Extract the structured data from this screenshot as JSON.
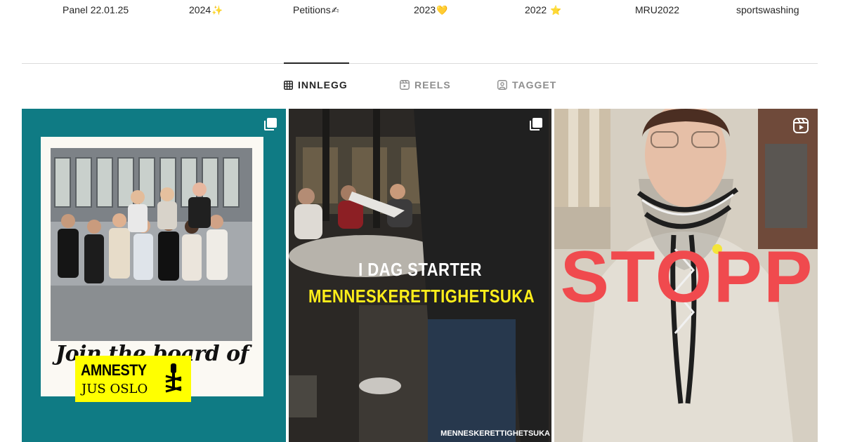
{
  "highlights": [
    {
      "label": "Panel 22.01.25",
      "emoji": ""
    },
    {
      "label": "2024",
      "emoji": "✨"
    },
    {
      "label": "Petitions",
      "emoji": "✍"
    },
    {
      "label": "2023",
      "emoji": "💛"
    },
    {
      "label": "2022",
      "emoji": "⭐"
    },
    {
      "label": "MRU2022",
      "emoji": ""
    },
    {
      "label": "sportswashing",
      "emoji": ""
    }
  ],
  "tabs": [
    {
      "label": "INNLEGG",
      "icon": "grid-icon",
      "active": true
    },
    {
      "label": "REELS",
      "icon": "reels-icon",
      "active": false
    },
    {
      "label": "TAGGET",
      "icon": "tagged-icon",
      "active": false
    }
  ],
  "posts": [
    {
      "type": "carousel",
      "badge_icon": "carousel-icon",
      "caption": "Join the board of",
      "logo_line1": "AMNESTY",
      "logo_line2": "JUS OSLO"
    },
    {
      "type": "carousel",
      "badge_icon": "carousel-icon",
      "line1": "I DAG STARTER",
      "line2": "MENNESKERETTIGHETSUKA",
      "footer": "MENNESKERETTIGHETSUKA"
    },
    {
      "type": "reel",
      "badge_icon": "reel-icon",
      "overlay": "STOPP"
    }
  ],
  "colors": {
    "tile1_bg": "#0f7b84",
    "amnesty_yellow": "#ffff00",
    "highlight_text_yellow": "#ffee1a",
    "stopp_red": "#f04a4e"
  }
}
